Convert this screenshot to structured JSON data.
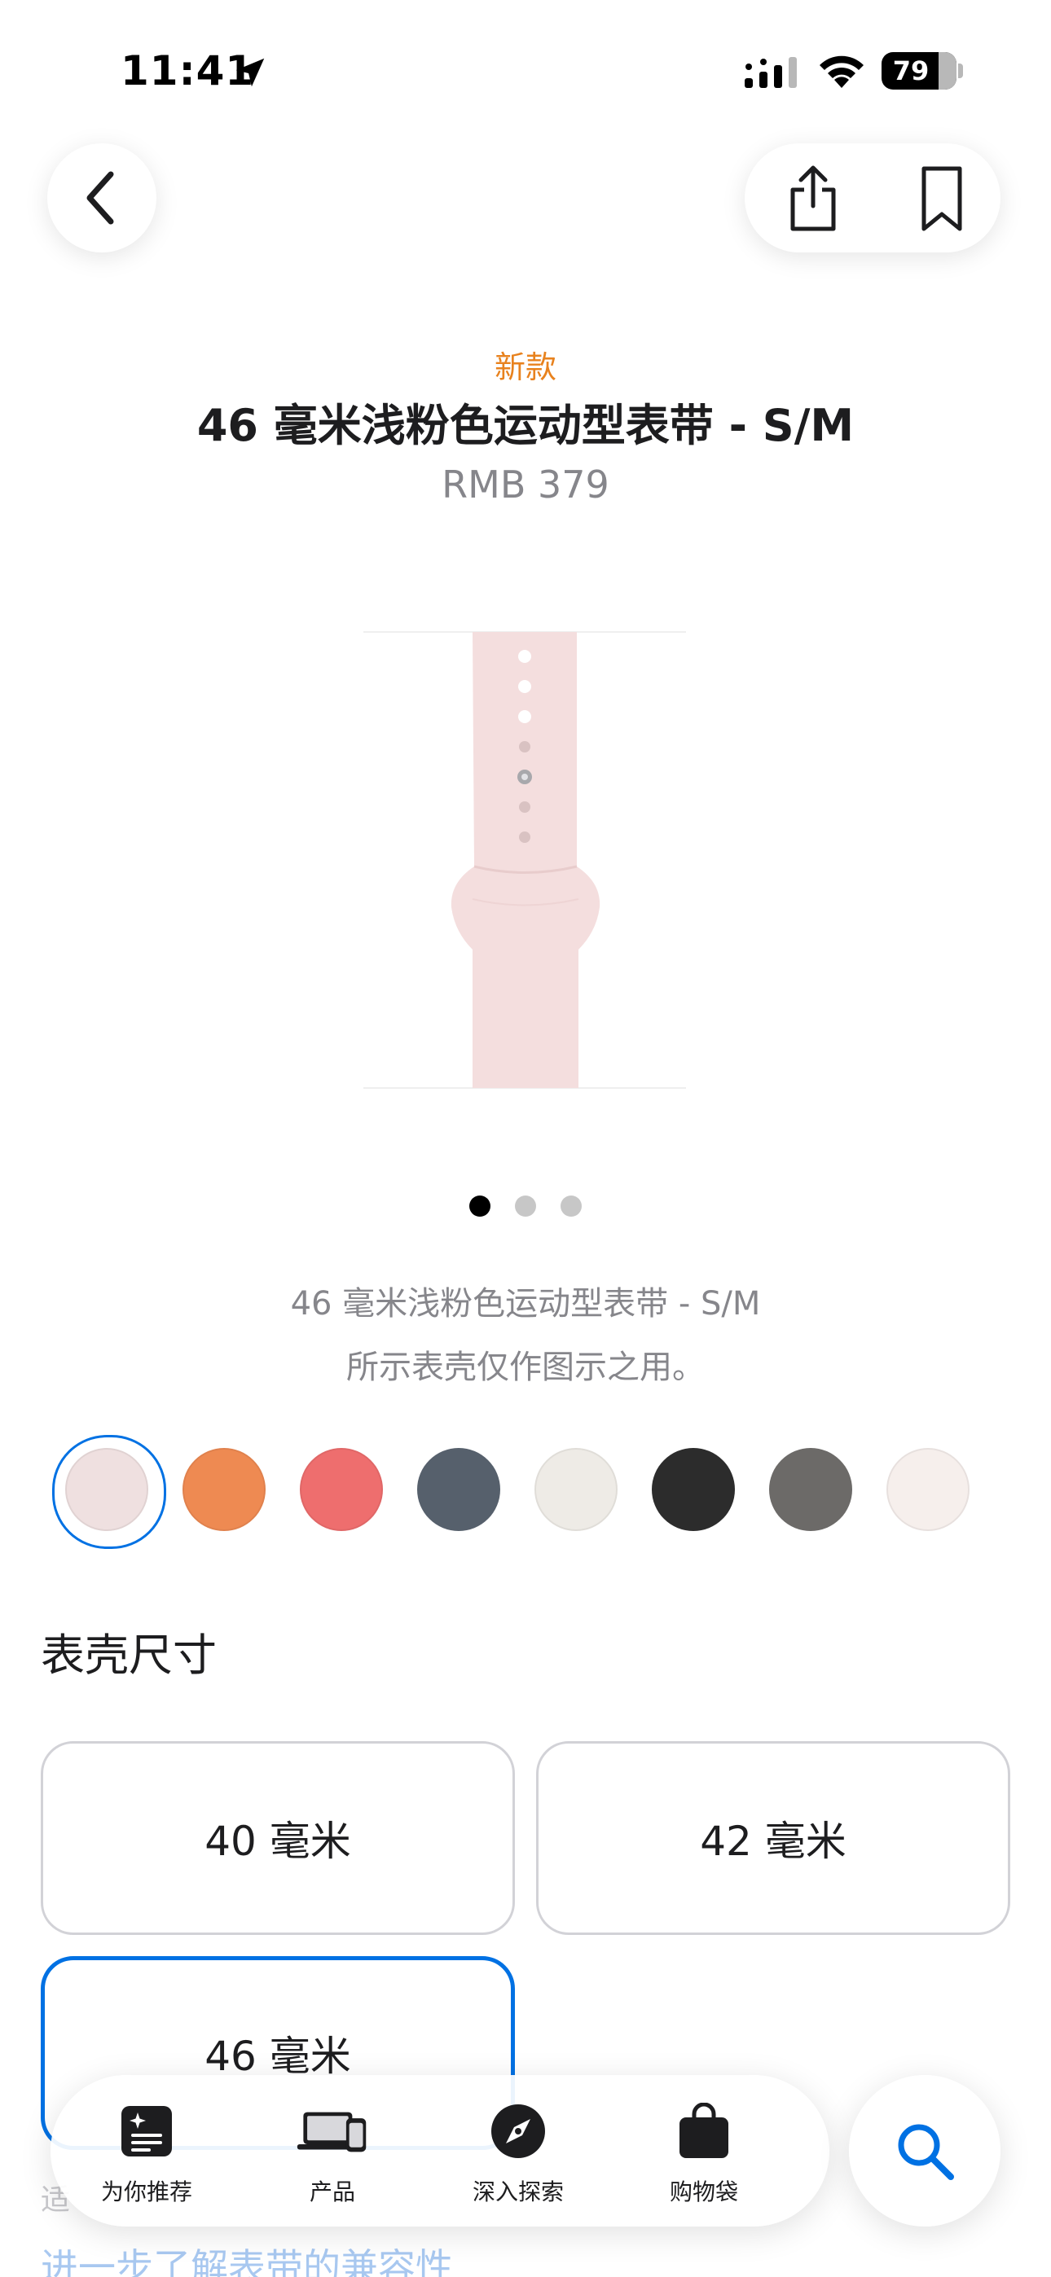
{
  "status_bar": {
    "time": "11:41",
    "battery_level": "79",
    "icons": [
      "location-arrow-icon",
      "signal-icon",
      "wifi-icon",
      "battery-icon"
    ]
  },
  "header": {
    "icons": [
      "chevron-left-icon",
      "share-icon",
      "bookmark-icon"
    ]
  },
  "product": {
    "badge": "新款",
    "title": "46 毫米浅粉色运动型表带 - S/M",
    "price": "RMB 379",
    "image_caption": "46 毫米浅粉色运动型表带 - S/M",
    "image_note": "所示表壳仅作图示之用。",
    "band_color": "#f4dede"
  },
  "pager": {
    "total": 3,
    "active_index": 0
  },
  "colors": {
    "selected_index": 0,
    "swatches": [
      {
        "color": "#efe0e0",
        "name": "light-pink-swatch"
      },
      {
        "color": "#ee8a52",
        "name": "orange-swatch"
      },
      {
        "color": "#ee6e6e",
        "name": "red-swatch"
      },
      {
        "color": "#56606c",
        "name": "slate-swatch"
      },
      {
        "color": "#eeebe6",
        "name": "starlight-swatch"
      },
      {
        "color": "#2c2c2c",
        "name": "black-swatch"
      },
      {
        "color": "#6c6a68",
        "name": "gray-swatch"
      },
      {
        "color": "#f6efec",
        "name": "white-swatch"
      }
    ]
  },
  "case_size": {
    "section_title": "表壳尺寸",
    "options": [
      "40 毫米",
      "42 毫米",
      "46 毫米"
    ],
    "selected": "46 毫米"
  },
  "partial": {
    "compat_text": "适",
    "learn_more_link": "进一步了解表带的兼容性"
  },
  "tab_bar": {
    "tabs": [
      {
        "label": "为你推荐",
        "icon": "for-you-icon"
      },
      {
        "label": "产品",
        "icon": "devices-icon"
      },
      {
        "label": "深入探索",
        "icon": "compass-icon"
      },
      {
        "label": "购物袋",
        "icon": "bag-icon"
      }
    ],
    "search_icon": "search-icon"
  },
  "theme": {
    "accent": "#0071e3",
    "badge_color": "#e8821e",
    "secondary_text": "#86868b"
  }
}
